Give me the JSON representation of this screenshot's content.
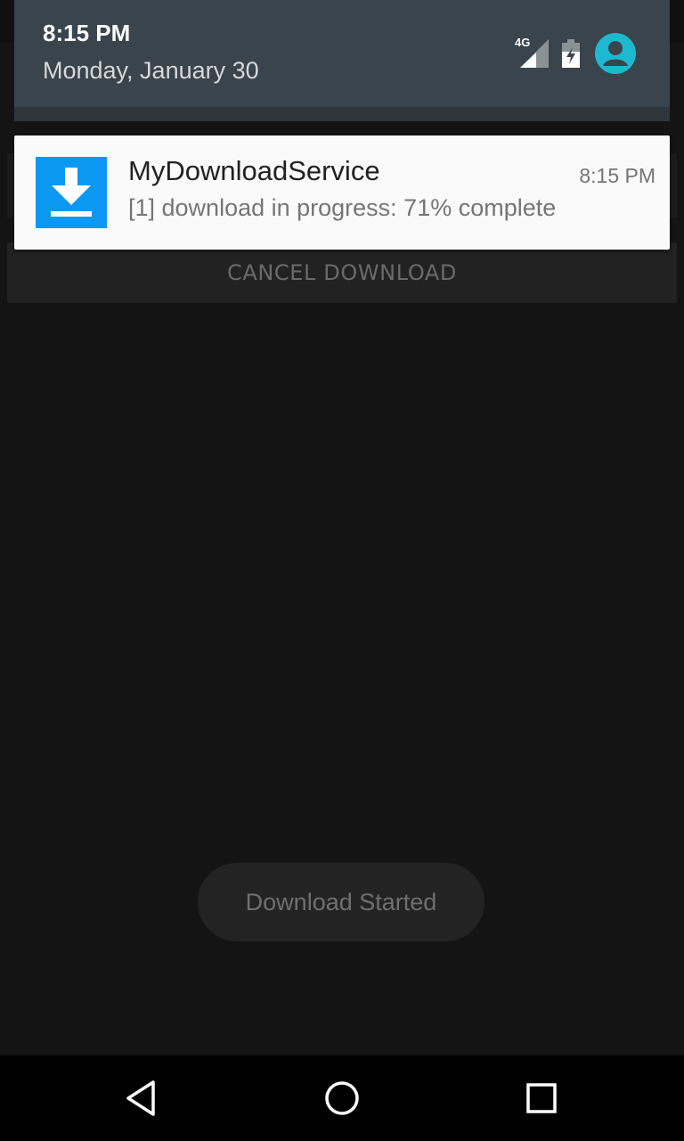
{
  "status_bar": {
    "time": "8:15 PM",
    "date": "Monday, January 30",
    "network_label": "4G",
    "icons": [
      "signal-icon",
      "battery-charging-icon",
      "user-avatar-icon"
    ],
    "accent_color": "#1eb8d0"
  },
  "notification": {
    "app_name": "MyDownloadService",
    "time": "8:15 PM",
    "text": "[1] download in progress: 71% complete",
    "progress_percent": 71,
    "icon": "download-icon",
    "icon_color": "#0a98f3"
  },
  "app": {
    "cancel_button_label": "CANCEL DOWNLOAD"
  },
  "toast": {
    "message": "Download Started"
  },
  "navigation_bar": {
    "buttons": [
      "back-icon",
      "home-icon",
      "recents-icon"
    ]
  }
}
